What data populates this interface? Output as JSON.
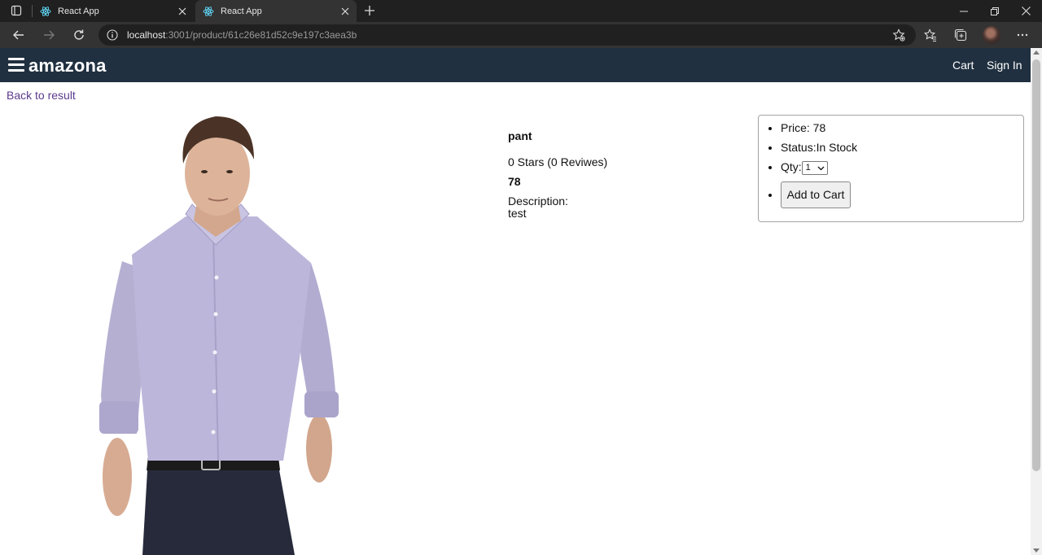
{
  "browser": {
    "tabs": [
      {
        "title": "React App"
      },
      {
        "title": "React App"
      }
    ],
    "url_host": "localhost",
    "url_rest": ":3001/product/61c26e81d52c9e197c3aea3b"
  },
  "header": {
    "brand": "amazona",
    "cart_label": "Cart",
    "signin_label": "Sign In"
  },
  "nav": {
    "back_label": "Back to result"
  },
  "product": {
    "name": "pant",
    "rating_text": "0 Stars (0 Reviwes)",
    "price": "78",
    "description_label": "Description:",
    "description": "test"
  },
  "cart_card": {
    "price_line": "Price: 78",
    "status_line": "Status:In Stock",
    "qty_label": "Qty:",
    "qty_value": "1",
    "add_button": "Add to Cart"
  },
  "colors": {
    "header_bg": "#203040",
    "link": "#5b3a8c"
  }
}
